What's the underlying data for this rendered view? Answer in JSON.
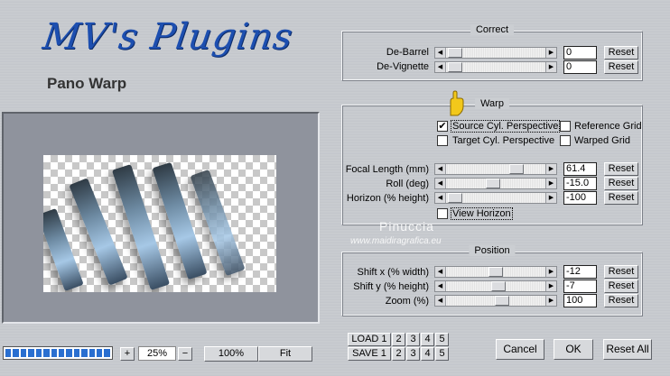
{
  "header": {
    "logo_text": "MV's Plugins",
    "subtitle": "Pano Warp"
  },
  "correct": {
    "title": "Correct",
    "rows": [
      {
        "label": "De-Barrel",
        "value": "0",
        "reset": "Reset",
        "level": 0.02
      },
      {
        "label": "De-Vignette",
        "value": "0",
        "reset": "Reset",
        "level": 0.02
      }
    ]
  },
  "warp": {
    "title": "Warp",
    "source_cyl": {
      "label": "Source Cyl. Perspective",
      "checked": true
    },
    "reference_grid": {
      "label": "Reference Grid",
      "checked": false
    },
    "target_cyl": {
      "label": "Target Cyl. Perspective",
      "checked": false
    },
    "warped_grid": {
      "label": "Warped Grid",
      "checked": false
    },
    "rows": [
      {
        "label": "Focal Length (mm)",
        "value": "61.4",
        "reset": "Reset",
        "level": 0.62
      },
      {
        "label": "Roll (deg)",
        "value": "-15.0",
        "reset": "Reset",
        "level": 0.42
      },
      {
        "label": "Horizon (% height)",
        "value": "-100",
        "reset": "Reset",
        "level": 0.02
      }
    ],
    "view_horizon": {
      "label": "View Horizon",
      "checked": false
    }
  },
  "position": {
    "title": "Position",
    "rows": [
      {
        "label": "Shift x (% width)",
        "value": "-12",
        "reset": "Reset",
        "level": 0.44
      },
      {
        "label": "Shift y (% height)",
        "value": "-7",
        "reset": "Reset",
        "level": 0.47
      },
      {
        "label": "Zoom (%)",
        "value": "100",
        "reset": "Reset",
        "level": 0.5
      }
    ]
  },
  "zoom_bar": {
    "plus": "+",
    "zoom_value": "25%",
    "minus": "−",
    "hundred": "100%",
    "fit": "Fit"
  },
  "load_save": {
    "load_label": "LOAD 1",
    "save_label": "SAVE 1",
    "slots": [
      "2",
      "3",
      "4",
      "5"
    ]
  },
  "actions": {
    "cancel": "Cancel",
    "ok": "OK",
    "reset_all": "Reset All"
  },
  "watermark": {
    "name": "Pinuccia",
    "url": "www.maidiragrafica.eu"
  },
  "progress": {
    "segments": 15,
    "filled": 15
  },
  "colors": {
    "logo": "#1d4fb0",
    "progress": "#2a6fd0",
    "cursor": "#f2c81b"
  }
}
